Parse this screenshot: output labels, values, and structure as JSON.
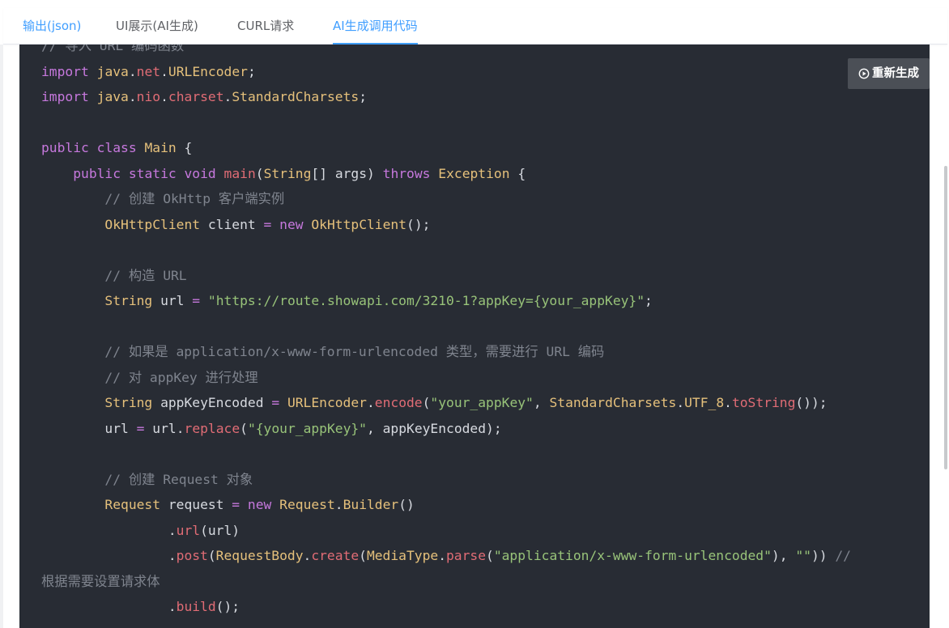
{
  "tabs": [
    {
      "label": "输出(json)"
    },
    {
      "label": "UI展示(AI生成)"
    },
    {
      "label": "CURL请求"
    },
    {
      "label": "AI生成调用代码"
    }
  ],
  "regenerate_button": {
    "label": "重新生成"
  },
  "code": {
    "l0": "// 导入 URL 编码函数",
    "l1_kw": "import",
    "l1_pkg1": "java",
    "l1_pkg2": "net",
    "l1_cls": "URLEncoder",
    "l2_kw": "import",
    "l2_pkg1": "java",
    "l2_pkg2": "nio",
    "l2_pkg3": "charset",
    "l2_cls": "StandardCharsets",
    "l4_kw1": "public",
    "l4_kw2": "class",
    "l4_cls": "Main",
    "l5_kw1": "public",
    "l5_kw2": "static",
    "l5_kw3": "void",
    "l5_fn": "main",
    "l5_ty": "String",
    "l5_arg": "args",
    "l5_kw4": "throws",
    "l5_exc": "Exception",
    "l6": "// 创建 OkHttp 客户端实例",
    "l7_ty": "OkHttpClient",
    "l7_var": "client",
    "l7_new": "new",
    "l7_ctor": "OkHttpClient",
    "l9": "// 构造 URL",
    "l10_ty": "String",
    "l10_var": "url",
    "l10_str": "\"https://route.showapi.com/3210-1?appKey={your_appKey}\"",
    "l12": "// 如果是 application/x-www-form-urlencoded 类型，需要进行 URL 编码",
    "l13": "// 对 appKey 进行处理",
    "l14_ty": "String",
    "l14_var": "appKeyEncoded",
    "l14_cls": "URLEncoder",
    "l14_fn": "encode",
    "l14_str": "\"your_appKey\"",
    "l14_cls2": "StandardCharsets",
    "l14_const": "UTF_8",
    "l14_fn2": "toString",
    "l15_var": "url",
    "l15_obj": "url",
    "l15_fn": "replace",
    "l15_str": "\"{your_appKey}\"",
    "l15_arg": "appKeyEncoded",
    "l17": "// 创建 Request 对象",
    "l18_ty": "Request",
    "l18_var": "request",
    "l18_new": "new",
    "l18_cls": "Request",
    "l18_cls2": "Builder",
    "l19_fn": "url",
    "l19_arg": "url",
    "l20_fn": "post",
    "l20_cls": "RequestBody",
    "l20_fn2": "create",
    "l20_cls2": "MediaType",
    "l20_fn3": "parse",
    "l20_str": "\"application/x-www-form-urlencoded\"",
    "l20_str2": "\"\"",
    "l20_cm": "//",
    "l21": "根据需要设置请求体",
    "l22_fn": "build"
  },
  "colors": {
    "accent": "#409eff",
    "code_bg": "#282c34",
    "keyword": "#c678dd",
    "type": "#e5c07b",
    "method": "#e06c75",
    "string": "#98c379",
    "comment": "#7f848e"
  }
}
